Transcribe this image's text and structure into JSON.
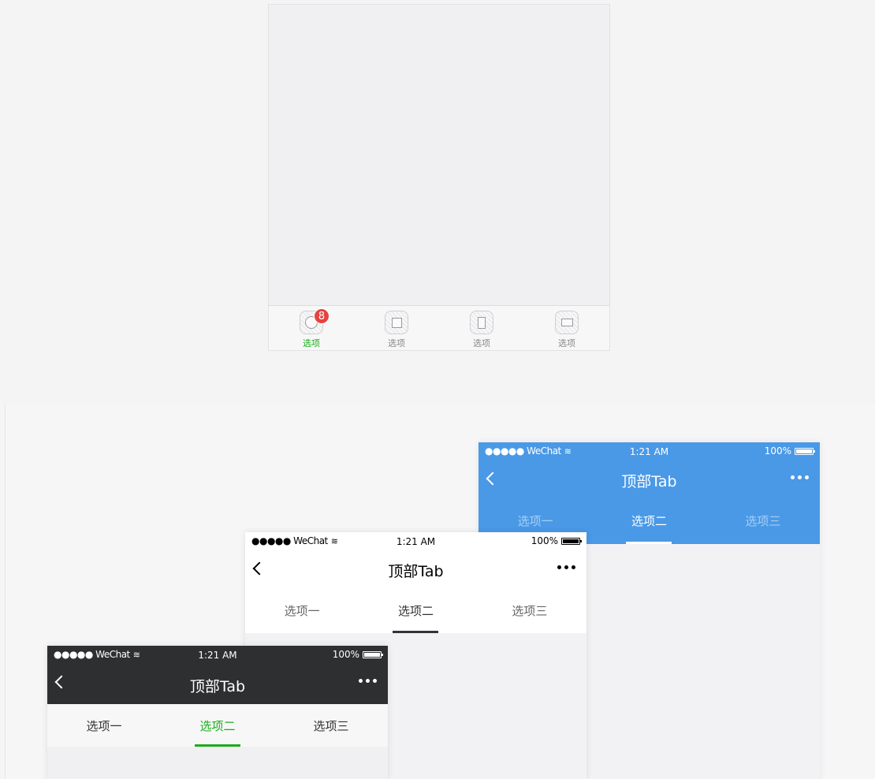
{
  "bottom_tabbar": {
    "items": [
      {
        "label": "选项",
        "icon": "circle-icon",
        "active": true,
        "badge": "8"
      },
      {
        "label": "选项",
        "icon": "square-icon",
        "active": false
      },
      {
        "label": "选项",
        "icon": "portrait-rect-icon",
        "active": false
      },
      {
        "label": "选项",
        "icon": "landscape-rect-icon",
        "active": false
      }
    ],
    "active_color": "#1aad19",
    "badge_color": "#e64340"
  },
  "variants": {
    "blue": {
      "status": {
        "carrier": "●●●●● WeChat",
        "time": "1:21 AM",
        "battery": "100%"
      },
      "title": "顶部Tab",
      "tabs": [
        "选项一",
        "选项二",
        "选项三"
      ],
      "active_tab": 1,
      "color": "#4a99e6"
    },
    "white": {
      "status": {
        "carrier": "●●●●● WeChat",
        "time": "1:21 AM",
        "battery": "100%"
      },
      "title": "顶部Tab",
      "tabs": [
        "选项一",
        "选项二",
        "选项三"
      ],
      "active_tab": 1,
      "color": "#ffffff"
    },
    "dark": {
      "status": {
        "carrier": "●●●●● WeChat",
        "time": "1:21 AM",
        "battery": "100%"
      },
      "title": "顶部Tab",
      "tabs": [
        "选项一",
        "选项二",
        "选项三"
      ],
      "active_tab": 1,
      "color": "#2e2f31"
    }
  }
}
